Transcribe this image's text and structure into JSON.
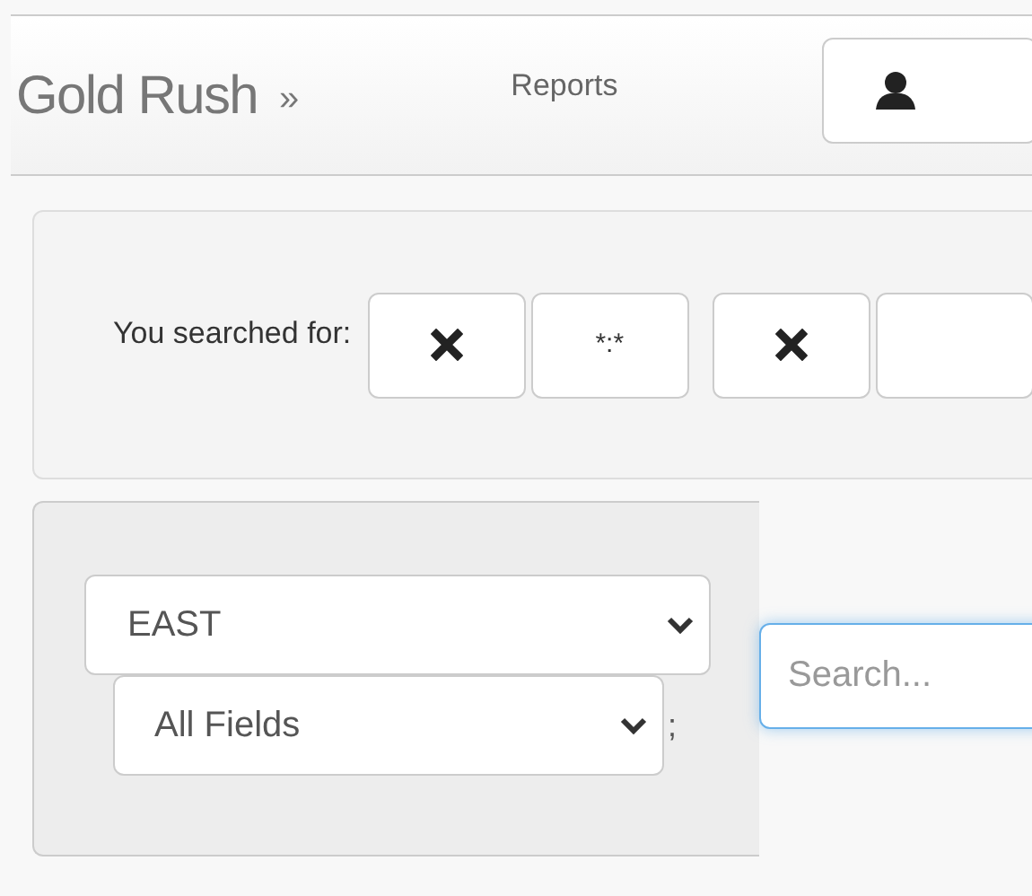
{
  "navbar": {
    "brand": "Gold Rush",
    "brand_separator": "»",
    "links": [
      {
        "label": "Reports"
      }
    ],
    "user_button": {
      "kind": "user"
    }
  },
  "search_summary": {
    "label": "You searched for:",
    "tokens": [
      {
        "kind": "remove"
      },
      {
        "kind": "term",
        "text": "*:*"
      },
      {
        "kind": "remove"
      },
      {
        "kind": "blank"
      }
    ]
  },
  "filters": {
    "selects": [
      {
        "value": "EAST"
      },
      {
        "value": "All Fields"
      }
    ],
    "separator": ";",
    "search": {
      "placeholder": "Search...",
      "focused": true
    }
  }
}
